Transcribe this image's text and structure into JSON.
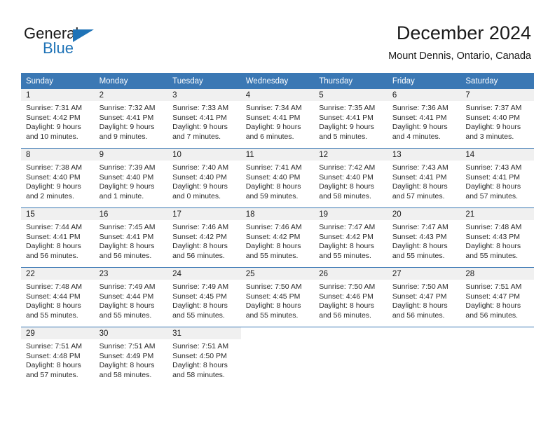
{
  "brand": {
    "name_part1": "General",
    "name_part2": "Blue",
    "triangle_color": "#1f73b7"
  },
  "header": {
    "title": "December 2024",
    "subtitle": "Mount Dennis, Ontario, Canada"
  },
  "theme": {
    "header_blue": "#3b78b4",
    "daynum_band": "#f0f0f0",
    "text": "#1a1a1a"
  },
  "weekdays": [
    "Sunday",
    "Monday",
    "Tuesday",
    "Wednesday",
    "Thursday",
    "Friday",
    "Saturday"
  ],
  "weeks": [
    [
      {
        "day": "1",
        "sunrise": "Sunrise: 7:31 AM",
        "sunset": "Sunset: 4:42 PM",
        "daylight1": "Daylight: 9 hours",
        "daylight2": "and 10 minutes."
      },
      {
        "day": "2",
        "sunrise": "Sunrise: 7:32 AM",
        "sunset": "Sunset: 4:41 PM",
        "daylight1": "Daylight: 9 hours",
        "daylight2": "and 9 minutes."
      },
      {
        "day": "3",
        "sunrise": "Sunrise: 7:33 AM",
        "sunset": "Sunset: 4:41 PM",
        "daylight1": "Daylight: 9 hours",
        "daylight2": "and 7 minutes."
      },
      {
        "day": "4",
        "sunrise": "Sunrise: 7:34 AM",
        "sunset": "Sunset: 4:41 PM",
        "daylight1": "Daylight: 9 hours",
        "daylight2": "and 6 minutes."
      },
      {
        "day": "5",
        "sunrise": "Sunrise: 7:35 AM",
        "sunset": "Sunset: 4:41 PM",
        "daylight1": "Daylight: 9 hours",
        "daylight2": "and 5 minutes."
      },
      {
        "day": "6",
        "sunrise": "Sunrise: 7:36 AM",
        "sunset": "Sunset: 4:41 PM",
        "daylight1": "Daylight: 9 hours",
        "daylight2": "and 4 minutes."
      },
      {
        "day": "7",
        "sunrise": "Sunrise: 7:37 AM",
        "sunset": "Sunset: 4:40 PM",
        "daylight1": "Daylight: 9 hours",
        "daylight2": "and 3 minutes."
      }
    ],
    [
      {
        "day": "8",
        "sunrise": "Sunrise: 7:38 AM",
        "sunset": "Sunset: 4:40 PM",
        "daylight1": "Daylight: 9 hours",
        "daylight2": "and 2 minutes."
      },
      {
        "day": "9",
        "sunrise": "Sunrise: 7:39 AM",
        "sunset": "Sunset: 4:40 PM",
        "daylight1": "Daylight: 9 hours",
        "daylight2": "and 1 minute."
      },
      {
        "day": "10",
        "sunrise": "Sunrise: 7:40 AM",
        "sunset": "Sunset: 4:40 PM",
        "daylight1": "Daylight: 9 hours",
        "daylight2": "and 0 minutes."
      },
      {
        "day": "11",
        "sunrise": "Sunrise: 7:41 AM",
        "sunset": "Sunset: 4:40 PM",
        "daylight1": "Daylight: 8 hours",
        "daylight2": "and 59 minutes."
      },
      {
        "day": "12",
        "sunrise": "Sunrise: 7:42 AM",
        "sunset": "Sunset: 4:40 PM",
        "daylight1": "Daylight: 8 hours",
        "daylight2": "and 58 minutes."
      },
      {
        "day": "13",
        "sunrise": "Sunrise: 7:43 AM",
        "sunset": "Sunset: 4:41 PM",
        "daylight1": "Daylight: 8 hours",
        "daylight2": "and 57 minutes."
      },
      {
        "day": "14",
        "sunrise": "Sunrise: 7:43 AM",
        "sunset": "Sunset: 4:41 PM",
        "daylight1": "Daylight: 8 hours",
        "daylight2": "and 57 minutes."
      }
    ],
    [
      {
        "day": "15",
        "sunrise": "Sunrise: 7:44 AM",
        "sunset": "Sunset: 4:41 PM",
        "daylight1": "Daylight: 8 hours",
        "daylight2": "and 56 minutes."
      },
      {
        "day": "16",
        "sunrise": "Sunrise: 7:45 AM",
        "sunset": "Sunset: 4:41 PM",
        "daylight1": "Daylight: 8 hours",
        "daylight2": "and 56 minutes."
      },
      {
        "day": "17",
        "sunrise": "Sunrise: 7:46 AM",
        "sunset": "Sunset: 4:42 PM",
        "daylight1": "Daylight: 8 hours",
        "daylight2": "and 56 minutes."
      },
      {
        "day": "18",
        "sunrise": "Sunrise: 7:46 AM",
        "sunset": "Sunset: 4:42 PM",
        "daylight1": "Daylight: 8 hours",
        "daylight2": "and 55 minutes."
      },
      {
        "day": "19",
        "sunrise": "Sunrise: 7:47 AM",
        "sunset": "Sunset: 4:42 PM",
        "daylight1": "Daylight: 8 hours",
        "daylight2": "and 55 minutes."
      },
      {
        "day": "20",
        "sunrise": "Sunrise: 7:47 AM",
        "sunset": "Sunset: 4:43 PM",
        "daylight1": "Daylight: 8 hours",
        "daylight2": "and 55 minutes."
      },
      {
        "day": "21",
        "sunrise": "Sunrise: 7:48 AM",
        "sunset": "Sunset: 4:43 PM",
        "daylight1": "Daylight: 8 hours",
        "daylight2": "and 55 minutes."
      }
    ],
    [
      {
        "day": "22",
        "sunrise": "Sunrise: 7:48 AM",
        "sunset": "Sunset: 4:44 PM",
        "daylight1": "Daylight: 8 hours",
        "daylight2": "and 55 minutes."
      },
      {
        "day": "23",
        "sunrise": "Sunrise: 7:49 AM",
        "sunset": "Sunset: 4:44 PM",
        "daylight1": "Daylight: 8 hours",
        "daylight2": "and 55 minutes."
      },
      {
        "day": "24",
        "sunrise": "Sunrise: 7:49 AM",
        "sunset": "Sunset: 4:45 PM",
        "daylight1": "Daylight: 8 hours",
        "daylight2": "and 55 minutes."
      },
      {
        "day": "25",
        "sunrise": "Sunrise: 7:50 AM",
        "sunset": "Sunset: 4:45 PM",
        "daylight1": "Daylight: 8 hours",
        "daylight2": "and 55 minutes."
      },
      {
        "day": "26",
        "sunrise": "Sunrise: 7:50 AM",
        "sunset": "Sunset: 4:46 PM",
        "daylight1": "Daylight: 8 hours",
        "daylight2": "and 56 minutes."
      },
      {
        "day": "27",
        "sunrise": "Sunrise: 7:50 AM",
        "sunset": "Sunset: 4:47 PM",
        "daylight1": "Daylight: 8 hours",
        "daylight2": "and 56 minutes."
      },
      {
        "day": "28",
        "sunrise": "Sunrise: 7:51 AM",
        "sunset": "Sunset: 4:47 PM",
        "daylight1": "Daylight: 8 hours",
        "daylight2": "and 56 minutes."
      }
    ],
    [
      {
        "day": "29",
        "sunrise": "Sunrise: 7:51 AM",
        "sunset": "Sunset: 4:48 PM",
        "daylight1": "Daylight: 8 hours",
        "daylight2": "and 57 minutes."
      },
      {
        "day": "30",
        "sunrise": "Sunrise: 7:51 AM",
        "sunset": "Sunset: 4:49 PM",
        "daylight1": "Daylight: 8 hours",
        "daylight2": "and 58 minutes."
      },
      {
        "day": "31",
        "sunrise": "Sunrise: 7:51 AM",
        "sunset": "Sunset: 4:50 PM",
        "daylight1": "Daylight: 8 hours",
        "daylight2": "and 58 minutes."
      },
      {
        "day": "",
        "sunrise": "",
        "sunset": "",
        "daylight1": "",
        "daylight2": ""
      },
      {
        "day": "",
        "sunrise": "",
        "sunset": "",
        "daylight1": "",
        "daylight2": ""
      },
      {
        "day": "",
        "sunrise": "",
        "sunset": "",
        "daylight1": "",
        "daylight2": ""
      },
      {
        "day": "",
        "sunrise": "",
        "sunset": "",
        "daylight1": "",
        "daylight2": ""
      }
    ]
  ]
}
